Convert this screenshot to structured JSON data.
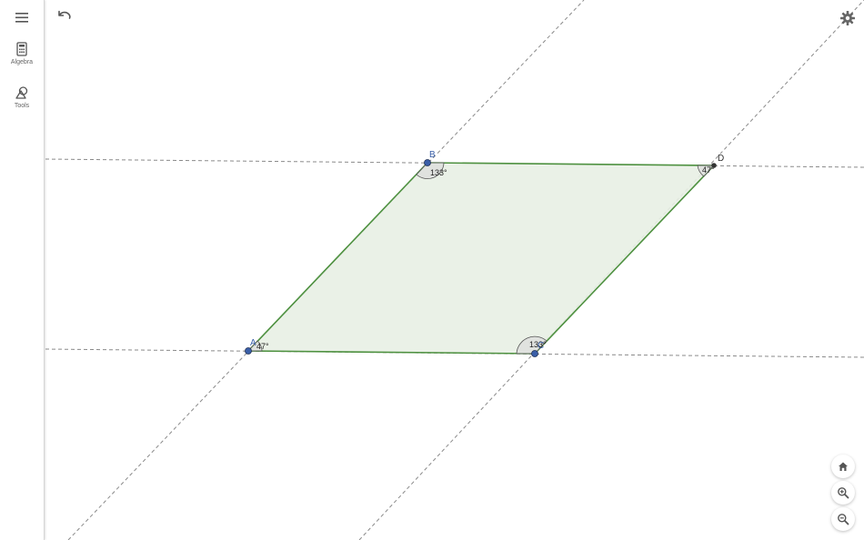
{
  "sidebar": {
    "menu_icon": "hamburger-menu-icon",
    "items": [
      {
        "label": "Algebra",
        "icon": "calculator-icon"
      },
      {
        "label": "Tools",
        "icon": "shapes-icon"
      }
    ]
  },
  "toolbar": {
    "undo_icon": "undo-icon",
    "settings_icon": "gear-icon"
  },
  "construction": {
    "points": [
      {
        "name": "A",
        "label": "A"
      },
      {
        "name": "B",
        "label": "B"
      },
      {
        "name": "C",
        "label": "C"
      },
      {
        "name": "D",
        "label": "D"
      }
    ],
    "angles": {
      "A": "47°",
      "B": "133°",
      "C": "133°",
      "D": "47°"
    }
  },
  "zoom_controls": [
    {
      "icon": "home-icon"
    },
    {
      "icon": "zoom-in-icon"
    },
    {
      "icon": "zoom-out-icon"
    }
  ],
  "colors": {
    "polygon_fill": "#e8f0e4",
    "polygon_edge": "#4e9140",
    "point_blue": "#3a5fa8",
    "point_black": "#333333",
    "label_blue": "#3a5fa8",
    "dashed_line": "#8a8a8a",
    "angle_fill": "#dcdcdc"
  }
}
